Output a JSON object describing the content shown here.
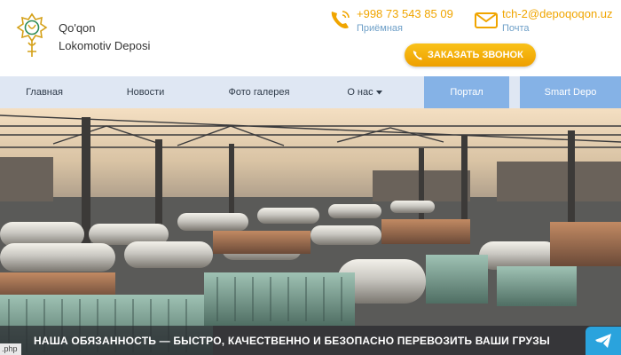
{
  "brand": {
    "line1": "Qo'qon",
    "line2": "Lokomotiv Deposi"
  },
  "contacts": {
    "phone": {
      "value": "+998 73 543 85 09",
      "label": "Приёмная",
      "icon": "phone-icon"
    },
    "email": {
      "value": "tch-2@depoqoqon.uz",
      "label": "Почта",
      "icon": "mail-icon"
    }
  },
  "callback_button": {
    "label": "ЗАКАЗАТЬ ЗВОНОК",
    "icon": "phone-icon"
  },
  "nav": {
    "items": [
      "Главная",
      "Новости",
      "Фото галерея",
      "О нас"
    ],
    "dropdown_icon": "caret-down-icon",
    "portal": "Портал",
    "smart": "Smart Depo"
  },
  "hero": {
    "caption": "НАША ОБЯЗАННОСТЬ — БЫСТРО, КАЧЕСТВЕННО И БЕЗОПАСНО ПЕРЕВОЗИТЬ ВАШИ ГРУЗЫ"
  },
  "footer_fragment": ".php",
  "colors": {
    "accent": "#f0a500",
    "nav_bg": "#dfe7f3",
    "nav_highlight": "#85b2e6",
    "telegram": "#2aa3dd"
  }
}
